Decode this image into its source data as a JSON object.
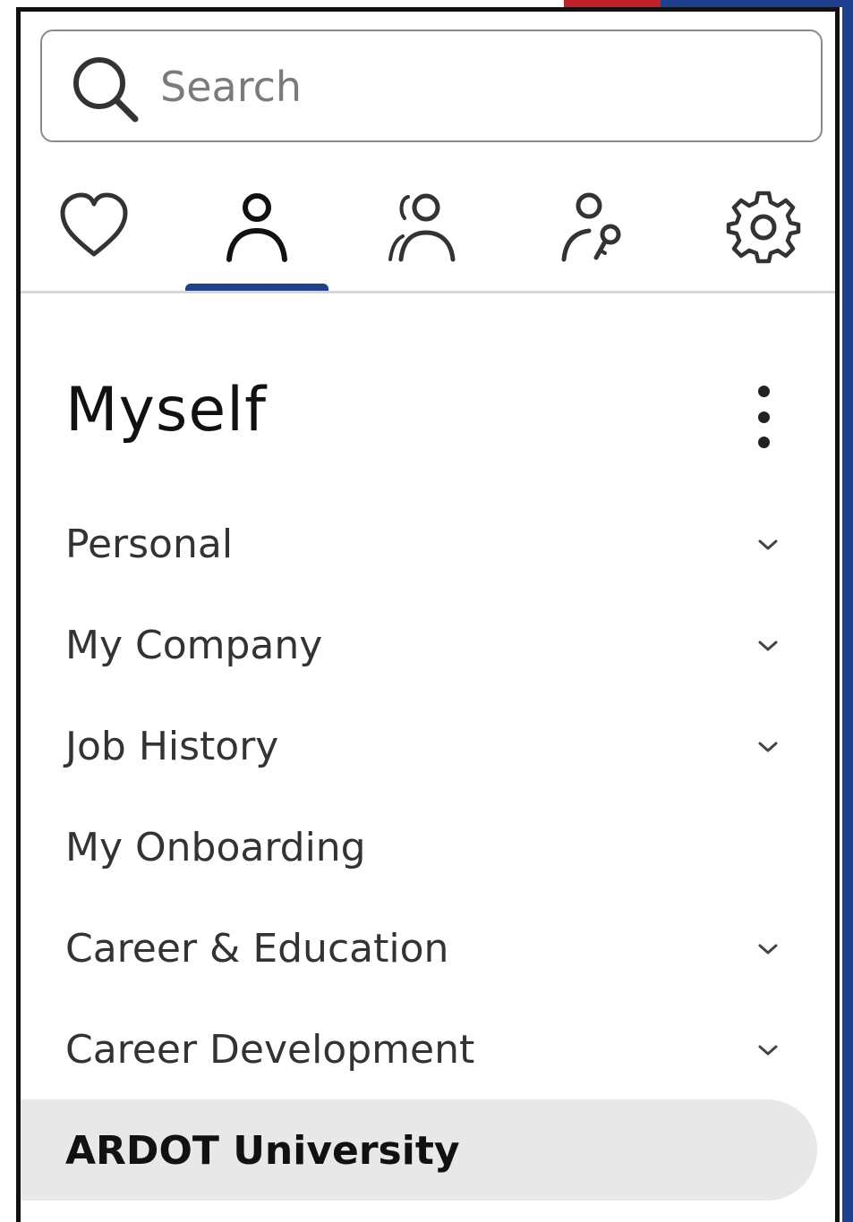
{
  "colors": {
    "accent": "#1f3f8f",
    "selected_bg": "#e8e8e8",
    "text": "#333333"
  },
  "search": {
    "placeholder": "Search",
    "value": "",
    "icon": "search-icon"
  },
  "tabs": [
    {
      "name": "favorites",
      "icon": "heart-icon",
      "active": false
    },
    {
      "name": "myself",
      "icon": "person-icon",
      "active": true
    },
    {
      "name": "my-team",
      "icon": "people-icon",
      "active": false
    },
    {
      "name": "administration",
      "icon": "person-key-icon",
      "active": false
    },
    {
      "name": "settings",
      "icon": "gear-icon",
      "active": false
    }
  ],
  "section": {
    "title": "Myself",
    "more_icon": "more-vertical-icon"
  },
  "menu": {
    "items": [
      {
        "label": "Personal",
        "expandable": true,
        "selected": false
      },
      {
        "label": "My Company",
        "expandable": true,
        "selected": false
      },
      {
        "label": "Job History",
        "expandable": true,
        "selected": false
      },
      {
        "label": "My Onboarding",
        "expandable": false,
        "selected": false
      },
      {
        "label": "Career & Education",
        "expandable": true,
        "selected": false
      },
      {
        "label": "Career Development",
        "expandable": true,
        "selected": false
      },
      {
        "label": "ARDOT University",
        "expandable": false,
        "selected": true
      }
    ]
  }
}
